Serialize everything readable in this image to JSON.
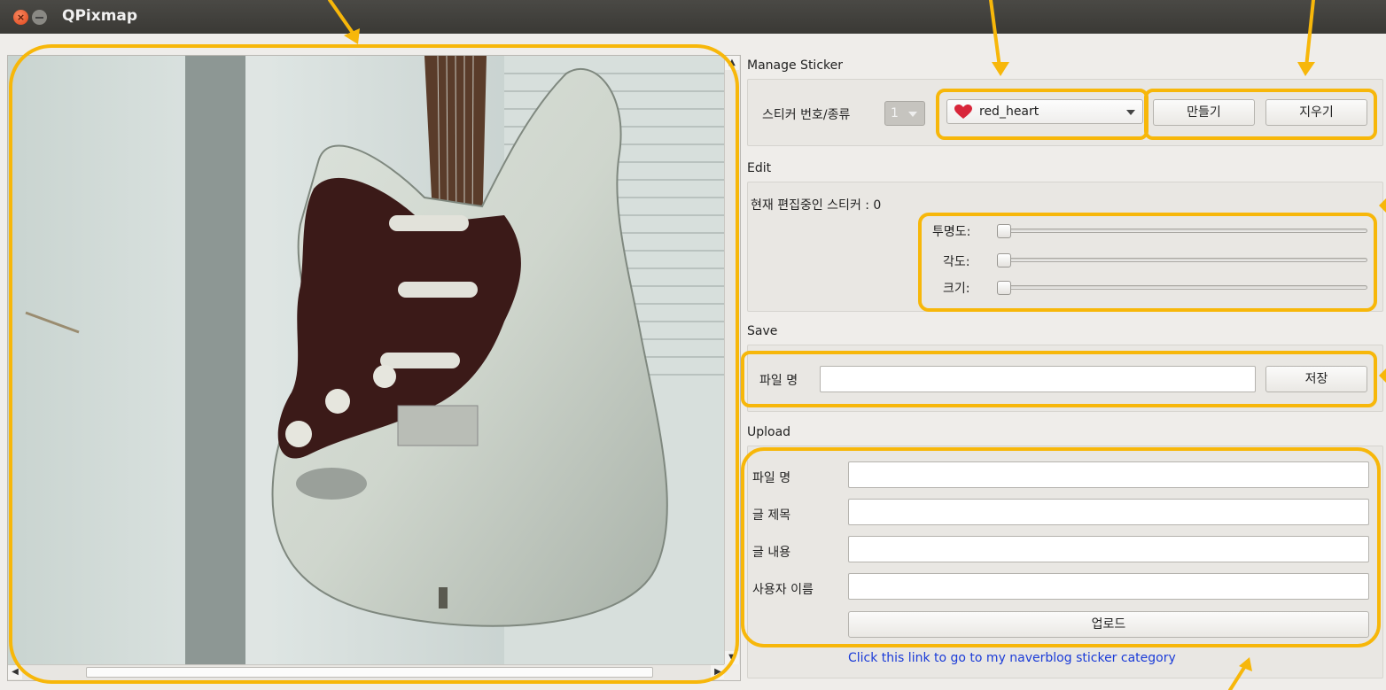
{
  "window": {
    "title": "QPixmap"
  },
  "image_view": {
    "scroll_up": "▲",
    "scroll_down": "▼",
    "scroll_left": "◀",
    "scroll_right": "▶"
  },
  "manage": {
    "title": "Manage Sticker",
    "label": "스티커 번호/종류",
    "number": "1",
    "kind": "red_heart",
    "create_label": "만들기",
    "delete_label": "지우기"
  },
  "edit": {
    "title": "Edit",
    "current": "현재 편집중인 스티커 : 0",
    "opacity_label": "투명도:",
    "angle_label": "각도:",
    "size_label": "크기:",
    "opacity_value": 0,
    "angle_value": 0,
    "size_value": 0
  },
  "save": {
    "title": "Save",
    "filename_label": "파일 명",
    "filename_value": "",
    "save_label": "저장"
  },
  "upload": {
    "title": "Upload",
    "filename_label": "파일 명",
    "post_title_label": "글 제목",
    "post_content_label": "글 내용",
    "username_label": "사용자 이름",
    "upload_label": "업로드",
    "link_text": "Click this link to go to my naverblog sticker category"
  },
  "colors": {
    "annotation": "#f7b70a",
    "link": "#1a3bd8",
    "titlebar": "#3c3b37"
  }
}
